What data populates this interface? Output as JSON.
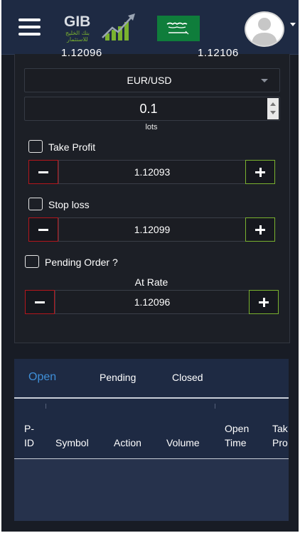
{
  "header": {
    "menu_icon": "hamburger-menu-icon",
    "logo": {
      "text": "GIB",
      "subtitle_line1": "بنك الخليج",
      "subtitle_line2": "للاستثمار"
    },
    "flag_icon": "saudi-flag-icon",
    "avatar_icon": "user-avatar-icon",
    "dropdown_icon": "caret-down-icon"
  },
  "quote": {
    "sell": "1.12096",
    "buy": "1.12106"
  },
  "order": {
    "symbol": "EUR/USD",
    "volume": "0.1",
    "volume_unit": "lots",
    "take_profit": {
      "label": "Take Profit",
      "value": "1.12093",
      "checked": false
    },
    "stop_loss": {
      "label": "Stop loss",
      "value": "1.12099",
      "checked": false
    },
    "pending": {
      "label": "Pending Order ?",
      "checked": false
    },
    "at_rate": {
      "label": "At Rate",
      "value": "1.12096"
    }
  },
  "positions": {
    "tabs": [
      {
        "label": "Open",
        "active": true
      },
      {
        "label": "Pending",
        "active": false
      },
      {
        "label": "Closed",
        "active": false
      }
    ],
    "columns": [
      {
        "line1": "P-",
        "line2": "ID"
      },
      {
        "line1": "",
        "line2": "Symbol"
      },
      {
        "line1": "",
        "line2": "Action"
      },
      {
        "line1": "",
        "line2": "Volume"
      },
      {
        "line1": "Open",
        "line2": "Time"
      },
      {
        "line1": "Tak",
        "line2": "Pro"
      }
    ],
    "rows": []
  },
  "colors": {
    "header_bg": "#1e2a43",
    "panel_bg": "#1c1f26",
    "minus_border": "#b4161c",
    "plus_border": "#7ab22f",
    "active_tab": "#3f8fd8"
  }
}
